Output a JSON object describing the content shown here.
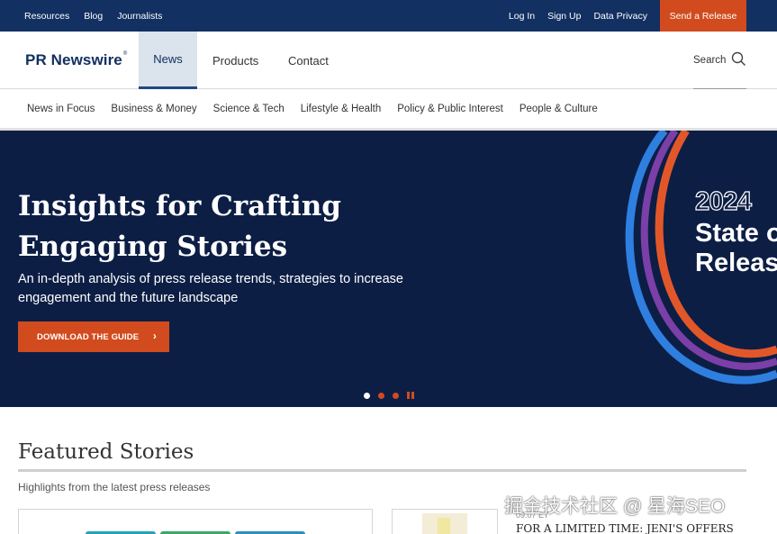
{
  "utility_bar": {
    "left_links": [
      "Resources",
      "Blog",
      "Journalists"
    ],
    "right_links": [
      "Log In",
      "Sign Up",
      "Data Privacy"
    ],
    "cta": "Send a Release"
  },
  "main_nav": {
    "logo": "PR Newswire",
    "logo_mark": "®",
    "tabs": [
      "News",
      "Products",
      "Contact"
    ],
    "active_tab": "News",
    "search_label": "Search"
  },
  "categories": [
    "News in Focus",
    "Business & Money",
    "Science & Tech",
    "Lifestyle & Health",
    "Policy & Public Interest",
    "People & Culture"
  ],
  "hero": {
    "title": "Insights for Crafting Engaging Stories",
    "subtitle": "An in-depth analysis of press release trends, strategies to increase engagement and the future landscape",
    "cta": "DOWNLOAD THE GUIDE",
    "graphic_year": "2024",
    "graphic_line1": "State of",
    "graphic_line2": "Releases",
    "carousel_active_index": 0,
    "carousel_count": 3
  },
  "featured": {
    "title": "Featured Stories",
    "subtitle": "Highlights from the latest press releases",
    "story_date": "09:07 ET",
    "story_headline": "FOR A LIMITED TIME: JENI'S OFFERS"
  },
  "watermark": "掘金技术社区 @ 星海SEO",
  "colors": {
    "navy": "#123061",
    "hero_bg": "#0d1e45",
    "accent": "#d14b1e"
  }
}
